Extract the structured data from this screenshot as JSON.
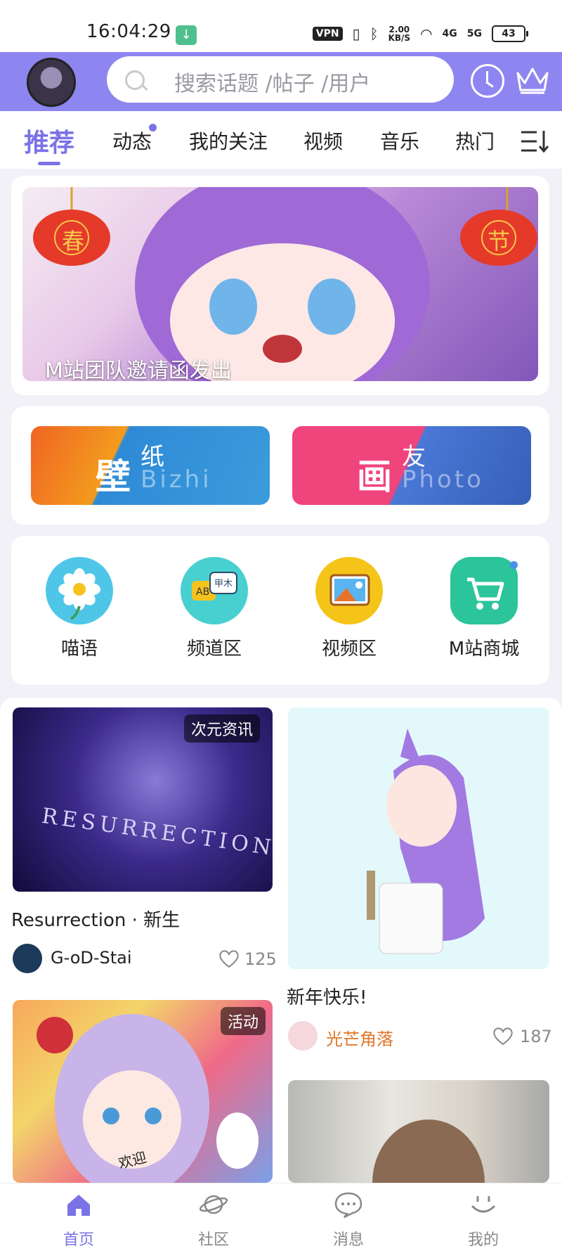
{
  "status_bar": {
    "time": "16:04:29",
    "vpn": "VPN",
    "net_speed_value": "2.00",
    "net_speed_unit": "KB/S",
    "signal_1": "4G",
    "signal_2": "5G",
    "battery": "43"
  },
  "header": {
    "search_placeholder": "搜索话题 /帖子 /用户"
  },
  "tabs": [
    {
      "label": "推荐",
      "active": true
    },
    {
      "label": "动态",
      "has_dot": true
    },
    {
      "label": "我的关注"
    },
    {
      "label": "视频"
    },
    {
      "label": "音乐"
    },
    {
      "label": "热门"
    }
  ],
  "banner": {
    "title": "M站团队邀请函发出",
    "lantern_left": "春",
    "lantern_right": "节"
  },
  "shortcuts": [
    {
      "big": "壁",
      "small": "纸",
      "en": "Bizhi"
    },
    {
      "big": "画",
      "small": "友",
      "en": "Photo"
    }
  ],
  "categories": [
    {
      "label": "喵语",
      "icon": "flower-icon"
    },
    {
      "label": "频道区",
      "icon": "chat-bubbles-icon"
    },
    {
      "label": "视频区",
      "icon": "picture-icon"
    },
    {
      "label": "M站商城",
      "icon": "shopping-cart-icon"
    }
  ],
  "posts": [
    {
      "tag": "次元资讯",
      "image_text": "RESURRECTION",
      "title": "Resurrection · 新生",
      "author": "G-oD-Stai",
      "likes": "125"
    },
    {
      "title": "新年快乐!",
      "author": "光芒角落",
      "likes": "187"
    },
    {
      "tag": "活动",
      "image_text": "欢迎"
    }
  ],
  "bottom_nav": [
    {
      "label": "首页",
      "active": true
    },
    {
      "label": "社区"
    },
    {
      "label": "消息"
    },
    {
      "label": "我的"
    }
  ],
  "colors": {
    "accent": "#7b72e6",
    "header_bg": "#8e86f0",
    "author_highlight": "#e0762a"
  }
}
